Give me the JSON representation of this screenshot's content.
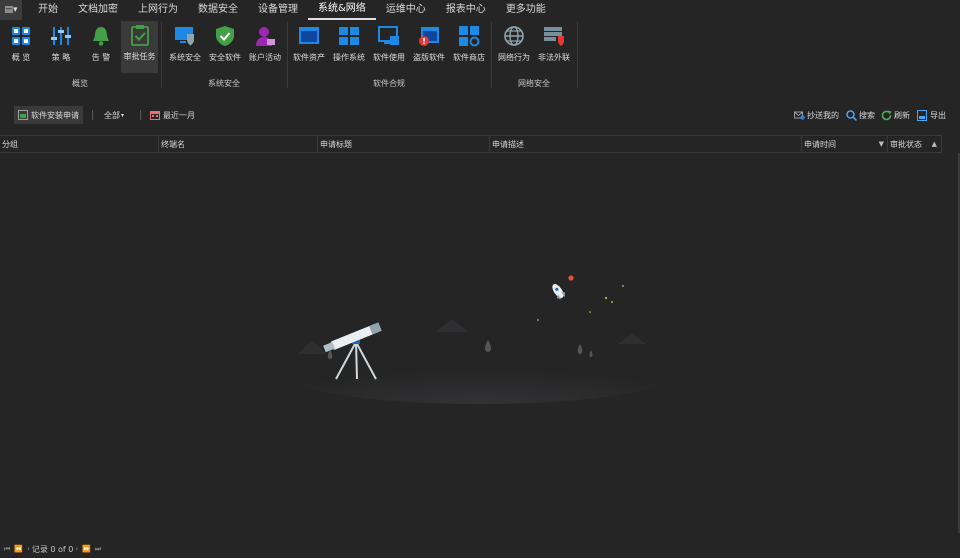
{
  "menu": {
    "app_icon": "app-menu-icon",
    "tabs": [
      "开始",
      "文档加密",
      "上网行为",
      "数据安全",
      "设备管理",
      "系统&网络",
      "运维中心",
      "报表中心",
      "更多功能"
    ],
    "active": "系统&网络"
  },
  "ribbon": {
    "groups": [
      {
        "label": "概览",
        "buttons": [
          "概 览",
          "策 略",
          "告 警",
          "审批任务"
        ]
      },
      {
        "label": "系统安全",
        "buttons": [
          "系统安全",
          "安全软件",
          "账户活动"
        ]
      },
      {
        "label": "软件合规",
        "buttons": [
          "软件资产",
          "操作系统",
          "软件使用",
          "盗版软件",
          "软件商店"
        ]
      },
      {
        "label": "网络安全",
        "buttons": [
          "网络行为",
          "非法外联"
        ]
      }
    ],
    "selected": "审批任务"
  },
  "toolbar": {
    "request_type": "软件安装申请",
    "scope": "全部",
    "period": "最近一月",
    "cc_me": "抄送我的",
    "search": "搜索",
    "refresh": "刷新",
    "export": "导出"
  },
  "table": {
    "columns": [
      "分组",
      "终端名",
      "申请标题",
      "申请描述",
      "申请时间",
      "审批状态"
    ]
  },
  "status": {
    "records": "记录 0 of 0"
  },
  "colors": {
    "background": "#252526",
    "accent_blue": "#1e88e5",
    "alert_green": "#4caf50",
    "purple": "#9c27b0",
    "red": "#e53935"
  }
}
